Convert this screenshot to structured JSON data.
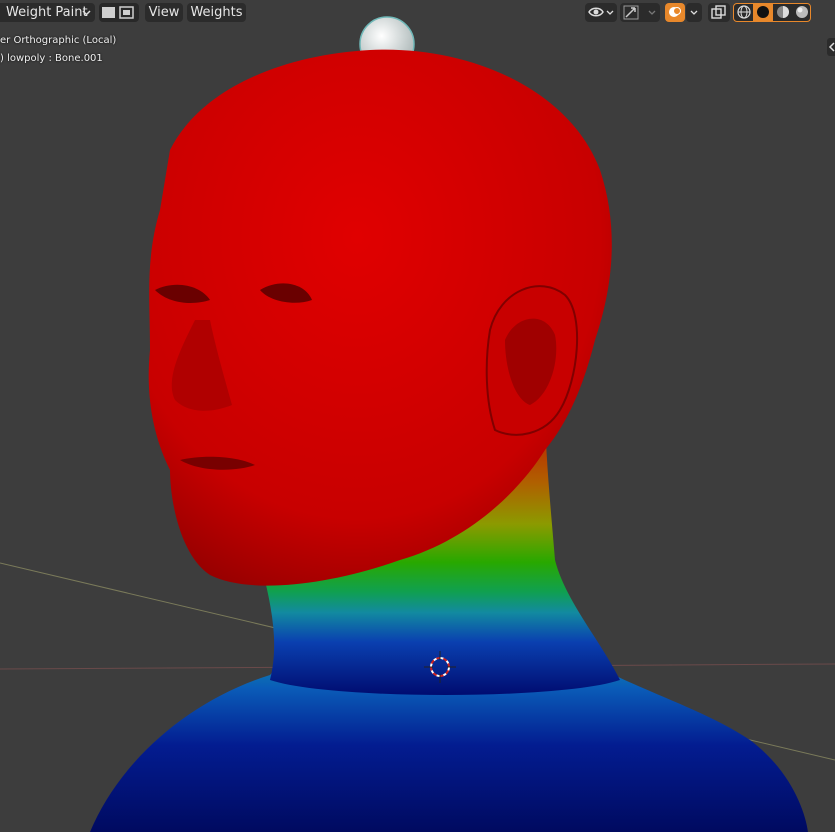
{
  "header": {
    "mode_label": "Weight Paint",
    "menu_view": "View",
    "menu_weights": "Weights"
  },
  "overlay": {
    "view_name": "er Orthographic (Local)",
    "object_info": ") lowpoly : Bone.001"
  },
  "icons": {
    "mode_dropdown": "chevron-down-icon",
    "transform": "transform-icon",
    "visibility": "eye-icon",
    "gizmo": "gizmo-icon",
    "overlay": "overlay-icon",
    "xray": "xray-icon",
    "shading_wire": "wireframe-shading-icon",
    "shading_solid": "solid-shading-icon",
    "shading_material": "material-shading-icon",
    "shading_rendered": "rendered-shading-icon"
  },
  "colors": {
    "viewport_bg": "#3d3d3d",
    "weight_full": "#d40000",
    "weight_zero": "#000c80",
    "accent": "#e8882b"
  }
}
